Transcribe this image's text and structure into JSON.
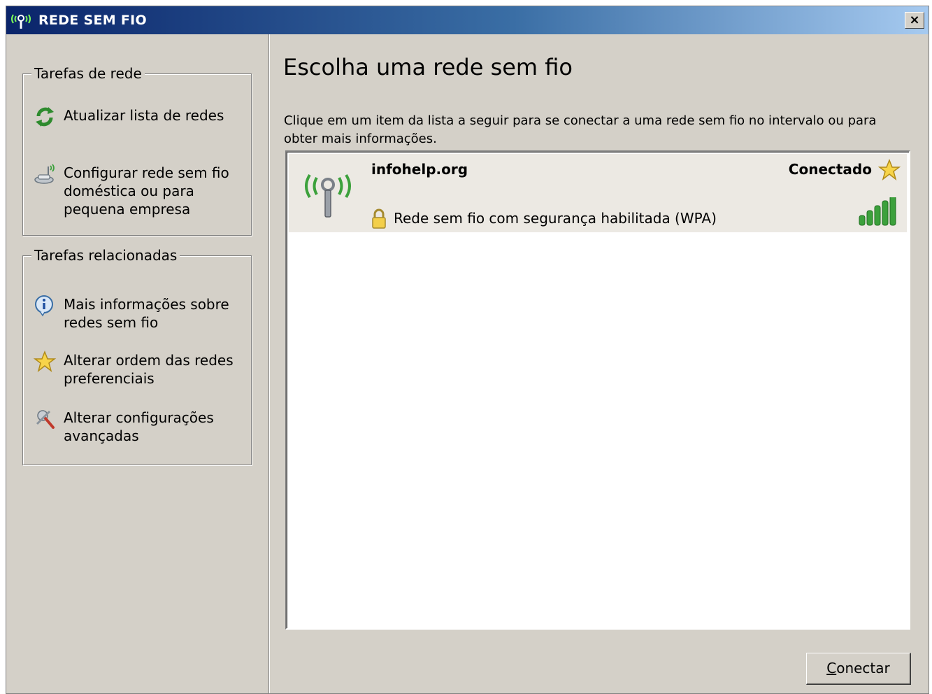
{
  "window": {
    "title": "REDE SEM FIO",
    "close_label": "×"
  },
  "sidebar": {
    "network_tasks": {
      "title": "Tarefas de rede",
      "items": [
        {
          "label": "Atualizar lista de redes",
          "icon": "refresh-icon"
        },
        {
          "label": "Configurar rede sem fio doméstica ou para pequena empresa",
          "icon": "wireless-setup-icon"
        }
      ]
    },
    "related_tasks": {
      "title": "Tarefas relacionadas",
      "items": [
        {
          "label": "Mais informações sobre redes sem fio",
          "icon": "info-icon"
        },
        {
          "label": "Alterar ordem das redes preferenciais",
          "icon": "star-icon"
        },
        {
          "label": "Alterar configurações avançadas",
          "icon": "advanced-settings-icon"
        }
      ]
    }
  },
  "main": {
    "heading": "Escolha uma rede sem fio",
    "instructions": "Clique em um item da lista a seguir para se conectar a uma rede sem fio no intervalo ou para obter mais informações.",
    "networks": [
      {
        "name": "infohelp.org",
        "status": "Conectado",
        "security": "Rede sem fio com segurança habilitada (WPA)",
        "signal_bars": 5,
        "signal_max": 5
      }
    ],
    "connect_button": "Conectar"
  },
  "colors": {
    "title_start": "#0a246a",
    "title_end": "#a6caf0",
    "face": "#d4d0c8",
    "signal_green": "#3ca13c"
  }
}
